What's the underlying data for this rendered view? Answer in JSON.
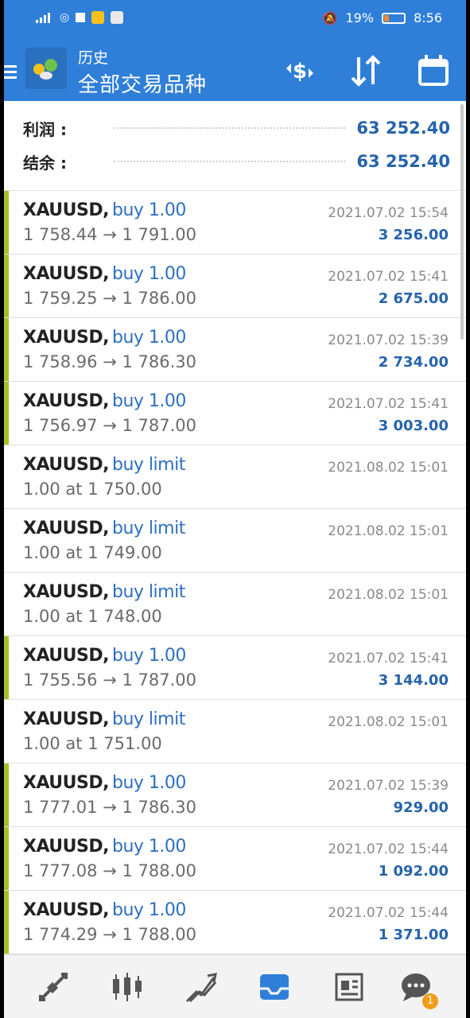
{
  "statusbar": {
    "battery": "19%",
    "time": "8:56"
  },
  "header": {
    "subtitle": "历史",
    "title": "全部交易品种"
  },
  "summary": [
    {
      "label": "利润 :",
      "value": "63 252.40"
    },
    {
      "label": "结余 :",
      "value": "63 252.40"
    }
  ],
  "trades": [
    {
      "symbol": "XAUUSD,",
      "type": "buy 1.00",
      "prices": "1 758.44 → 1 791.00",
      "time": "2021.07.02 15:54",
      "profit": "3 256.00"
    },
    {
      "symbol": "XAUUSD,",
      "type": "buy 1.00",
      "prices": "1 759.25 → 1 786.00",
      "time": "2021.07.02 15:41",
      "profit": "2 675.00"
    },
    {
      "symbol": "XAUUSD,",
      "type": "buy 1.00",
      "prices": "1 758.96 → 1 786.30",
      "time": "2021.07.02 15:39",
      "profit": "2 734.00"
    },
    {
      "symbol": "XAUUSD,",
      "type": "buy 1.00",
      "prices": "1 756.97 → 1 787.00",
      "time": "2021.07.02 15:41",
      "profit": "3 003.00"
    },
    {
      "symbol": "XAUUSD,",
      "type": "buy limit",
      "prices": "1.00 at 1 750.00",
      "time": "2021.08.02 15:01",
      "profit": ""
    },
    {
      "symbol": "XAUUSD,",
      "type": "buy limit",
      "prices": "1.00 at 1 749.00",
      "time": "2021.08.02 15:01",
      "profit": ""
    },
    {
      "symbol": "XAUUSD,",
      "type": "buy limit",
      "prices": "1.00 at 1 748.00",
      "time": "2021.08.02 15:01",
      "profit": ""
    },
    {
      "symbol": "XAUUSD,",
      "type": "buy 1.00",
      "prices": "1 755.56 → 1 787.00",
      "time": "2021.07.02 15:41",
      "profit": "3 144.00"
    },
    {
      "symbol": "XAUUSD,",
      "type": "buy limit",
      "prices": "1.00 at 1 751.00",
      "time": "2021.08.02 15:01",
      "profit": ""
    },
    {
      "symbol": "XAUUSD,",
      "type": "buy 1.00",
      "prices": "1 777.01 → 1 786.30",
      "time": "2021.07.02 15:39",
      "profit": "929.00"
    },
    {
      "symbol": "XAUUSD,",
      "type": "buy 1.00",
      "prices": "1 777.08 → 1 788.00",
      "time": "2021.07.02 15:44",
      "profit": "1 092.00"
    },
    {
      "symbol": "XAUUSD,",
      "type": "buy 1.00",
      "prices": "1 774.29 → 1 788.00",
      "time": "2021.07.02 15:44",
      "profit": "1 371.00"
    }
  ],
  "bottomnav": {
    "items": [
      "quotes-icon",
      "chart-icon",
      "trade-icon",
      "history-icon",
      "news-icon",
      "chat-icon"
    ],
    "active": "history-icon",
    "chat_badge": "1"
  },
  "colors": {
    "accent": "#2f7fd9",
    "profit": "#2563ad",
    "closed_marker": "#a8c020",
    "type_text": "#2f6fc0"
  }
}
